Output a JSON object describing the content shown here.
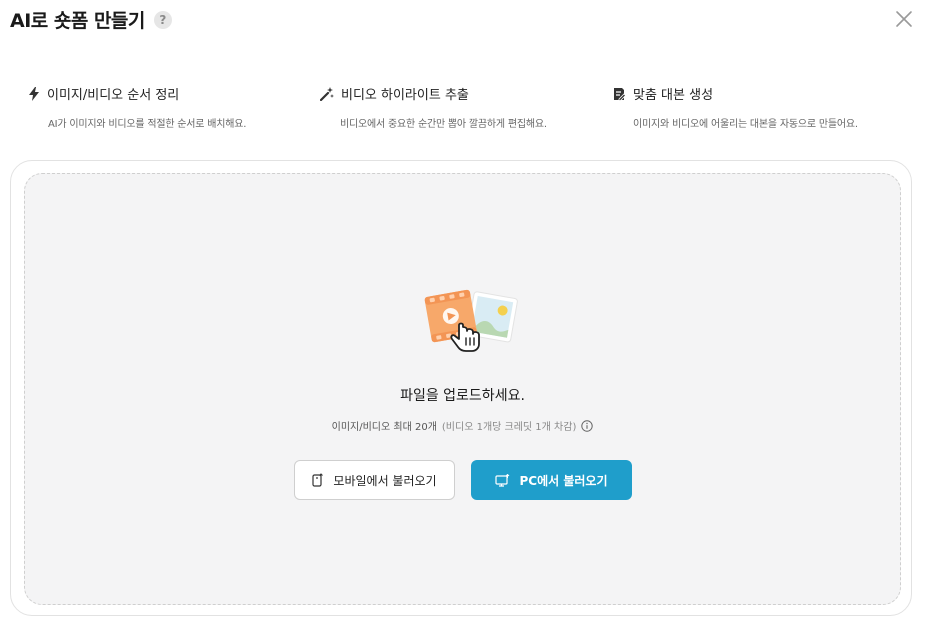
{
  "header": {
    "title": "AI로 숏폼 만들기",
    "help_label": "?"
  },
  "features": [
    {
      "icon": "bolt-icon",
      "title": "이미지/비디오 순서 정리",
      "desc": "AI가 이미지와 비디오를 적절한 순서로 배치해요."
    },
    {
      "icon": "magic-wand-icon",
      "title": "비디오 하이라이트 추출",
      "desc": "비디오에서 중요한 순간만 뽑아 깔끔하게 편집해요."
    },
    {
      "icon": "script-icon",
      "title": "맞춤 대본 생성",
      "desc": "이미지와 비디오에 어울리는 대본을 자동으로 만들어요."
    }
  ],
  "upload": {
    "title": "파일을 업로드하세요.",
    "limit": "이미지/비디오 최대 20개",
    "credit": "(비디오 1개당 크레딧 1개 차감)",
    "mobile_button": "모바일에서 불러오기",
    "pc_button": "PC에서 불러오기"
  },
  "colors": {
    "accent": "#1f9ecb",
    "dropzone_bg": "#f4f4f5"
  }
}
